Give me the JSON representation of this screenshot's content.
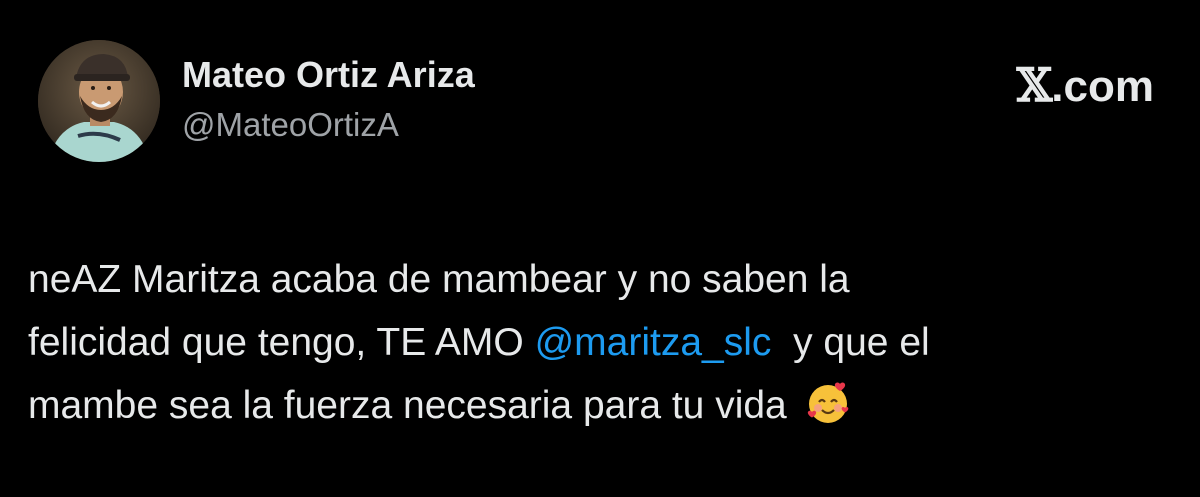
{
  "author": {
    "display_name": "Mateo Ortiz Ariza",
    "handle": "@MateoOrtizA"
  },
  "brand": {
    "x_glyph": "𝕏",
    "domain": ".com"
  },
  "tweet": {
    "line1": "neAZ Maritza acaba de mambear y no saben la",
    "line2_before": "felicidad que tengo, TE AMO ",
    "mention": "@maritza_slc",
    "line2_after": "  y que el",
    "line3": "mambe sea la fuerza necesaria para tu vida "
  },
  "icons": {
    "avatar": "profile-photo",
    "emoji": "smiling-face-with-hearts-emoji"
  },
  "colors": {
    "background": "#000000",
    "text": "#e7e9ea",
    "secondary_text": "#9fa3a7",
    "mention": "#1d9bf0"
  }
}
